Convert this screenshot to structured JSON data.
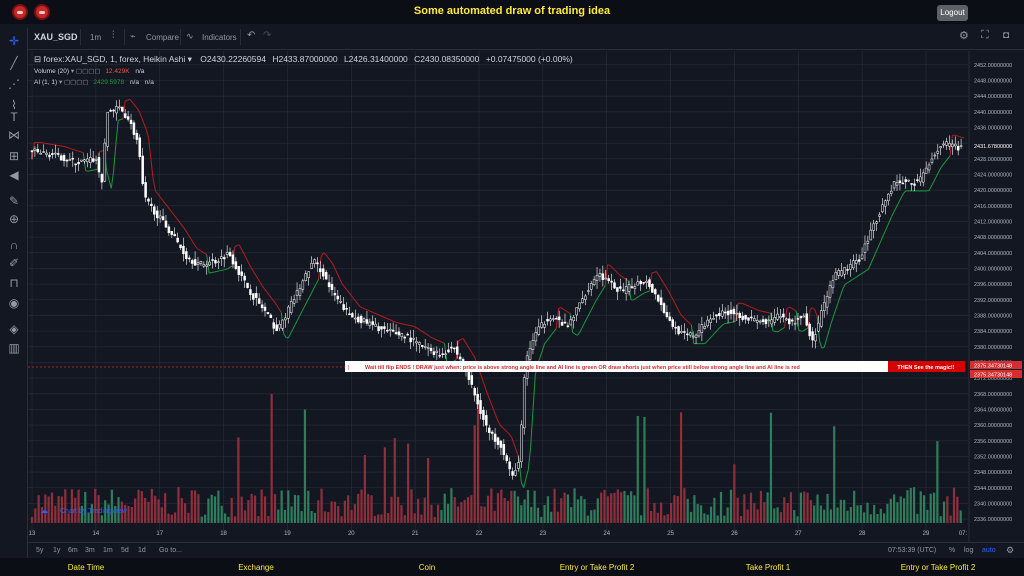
{
  "header": {
    "title": "Some automated draw of trading idea",
    "logout_label": "Logout"
  },
  "toolbar": {
    "symbol": "XAU_SGD",
    "interval": "1m",
    "compare_label": "Compare",
    "indicators_label": "Indicators"
  },
  "legend": {
    "main_title": "forex:XAU_SGD, 1, forex, Heikin Ashi",
    "open": "O2430.22260594",
    "high": "H2433.87000000",
    "low": "L2426.31400000",
    "close": "C2430.08350000",
    "change": "+0.07475000 (+0.00%)",
    "volume_label": "Volume (20)",
    "volume_value": "12.429K",
    "volume_ma": "n/a",
    "ai_label": "AI (1, 1)",
    "ai_value": "2429.5978",
    "ai_na1": "n/a",
    "ai_na2": "n/a"
  },
  "watermark": "Chart by TradingView",
  "banner": {
    "marker": "|",
    "text": "Wait till flip ENDS  !    DRAW just when:  price is above strong angle line and AI line is green          OR          draw shorts just when price still below strong angle line and AI line is red",
    "right_text": "THEN See the magic!!"
  },
  "price_labels": {
    "current": "2431.67800000",
    "banner_top": "2375.34730148",
    "banner_bottom": "2375.34730148"
  },
  "bottombar": {
    "ranges": [
      "5y",
      "1y",
      "6m",
      "3m",
      "1m",
      "5d",
      "1d"
    ],
    "goto": "Go to...",
    "time": "07:53:39 (UTC)",
    "pct": "%",
    "log": "log",
    "auto": "auto"
  },
  "footer": {
    "columns": [
      "Date Time",
      "Exchange",
      "Coin",
      "Entry or Take Profit 2",
      "Take Profit 1",
      "Entry or Take Profit 2"
    ]
  },
  "colors": {
    "bg": "#131722",
    "grid": "#2a2e39",
    "candle": "#ffffff",
    "ai_green": "#1b9a3a",
    "ai_red": "#b71c1c",
    "vol_up": "#2e7d5b",
    "vol_down": "#8e2f3c",
    "banner_text": "#d32f2f",
    "footer_text": "#ffeb3b"
  },
  "chart_data": {
    "type": "line",
    "title": "forex:XAU_SGD, 1, forex, Heikin Ashi",
    "x_tick_labels": [
      "13",
      "14",
      "17",
      "18",
      "19",
      "20",
      "21",
      "22",
      "23",
      "24",
      "25",
      "26",
      "27",
      "28",
      "29",
      "07:"
    ],
    "y_tick_labels": [
      "2452.00000000",
      "2448.00000000",
      "2444.00000000",
      "2440.00000000",
      "2436.00000000",
      "2432.00000000",
      "2428.00000000",
      "2424.00000000",
      "2420.00000000",
      "2416.00000000",
      "2412.00000000",
      "2408.00000000",
      "2404.00000000",
      "2400.00000000",
      "2396.00000000",
      "2392.00000000",
      "2388.00000000",
      "2384.00000000",
      "2380.00000000",
      "2376.00000000",
      "2372.00000000",
      "2368.00000000",
      "2364.00000000",
      "2360.00000000",
      "2356.00000000",
      "2352.00000000",
      "2348.00000000",
      "2344.00000000",
      "2340.00000000",
      "2336.00000000"
    ],
    "ylim": [
      2335,
      2454
    ],
    "xlim": [
      0,
      15.4
    ],
    "grid": true,
    "series": [
      {
        "values": [
          [
            0,
            2430
          ],
          [
            0.4,
            2429
          ],
          [
            0.8,
            2427
          ],
          [
            1.1,
            2428
          ],
          [
            1.2,
            2422
          ],
          [
            1.3,
            2440
          ],
          [
            1.5,
            2441
          ],
          [
            1.65,
            2438
          ],
          [
            1.8,
            2432
          ],
          [
            1.9,
            2418
          ],
          [
            2.1,
            2414
          ],
          [
            2.4,
            2408
          ],
          [
            2.6,
            2403
          ],
          [
            2.8,
            2401
          ],
          [
            3.1,
            2402
          ],
          [
            3.3,
            2404
          ],
          [
            3.5,
            2398
          ],
          [
            3.7,
            2393
          ],
          [
            3.9,
            2389
          ],
          [
            4.1,
            2384
          ],
          [
            4.3,
            2390
          ],
          [
            4.5,
            2396
          ],
          [
            4.7,
            2402
          ],
          [
            4.85,
            2399
          ],
          [
            5.0,
            2394
          ],
          [
            5.3,
            2388
          ],
          [
            5.6,
            2386
          ],
          [
            5.9,
            2384
          ],
          [
            6.2,
            2383
          ],
          [
            6.5,
            2380
          ],
          [
            6.8,
            2378
          ],
          [
            7.0,
            2380
          ],
          [
            7.2,
            2375
          ],
          [
            7.4,
            2366
          ],
          [
            7.6,
            2358
          ],
          [
            7.8,
            2355
          ],
          [
            8.0,
            2346
          ],
          [
            8.1,
            2352
          ],
          [
            8.2,
            2376
          ],
          [
            8.35,
            2383
          ],
          [
            8.6,
            2388
          ],
          [
            8.9,
            2385
          ],
          [
            9.2,
            2394
          ],
          [
            9.4,
            2399
          ],
          [
            9.6,
            2396
          ],
          [
            9.8,
            2394
          ],
          [
            10.0,
            2396
          ],
          [
            10.2,
            2397
          ],
          [
            10.4,
            2392
          ],
          [
            10.6,
            2386
          ],
          [
            10.8,
            2383
          ],
          [
            11.0,
            2383
          ],
          [
            11.3,
            2388
          ],
          [
            11.6,
            2389
          ],
          [
            11.9,
            2387
          ],
          [
            12.2,
            2386
          ],
          [
            12.4,
            2388
          ],
          [
            12.6,
            2386
          ],
          [
            12.8,
            2388
          ],
          [
            12.95,
            2381
          ],
          [
            13.1,
            2389
          ],
          [
            13.3,
            2398
          ],
          [
            13.5,
            2400
          ],
          [
            13.7,
            2402
          ],
          [
            13.9,
            2409
          ],
          [
            14.1,
            2416
          ],
          [
            14.3,
            2422
          ],
          [
            14.5,
            2422
          ],
          [
            14.7,
            2422
          ],
          [
            14.9,
            2428
          ],
          [
            15.1,
            2432
          ],
          [
            15.3,
            2431
          ]
        ]
      }
    ],
    "volume_axis_max": 50000
  }
}
